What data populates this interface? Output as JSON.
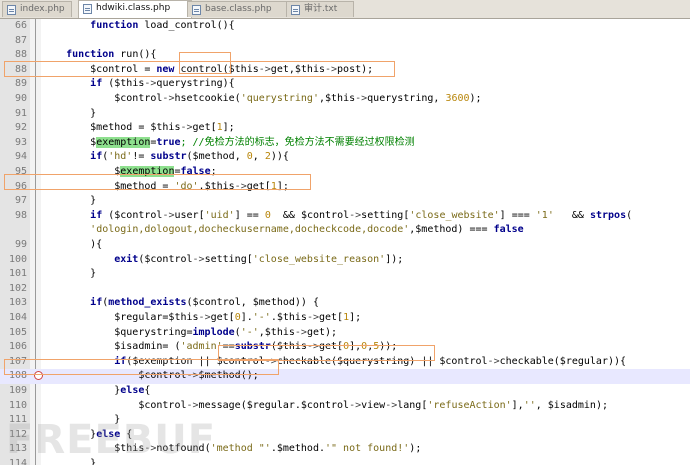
{
  "tabs": [
    {
      "label": "index.php",
      "active": false
    },
    {
      "label": "hdwiki.class.php",
      "active": true
    },
    {
      "label": "base.class.php",
      "active": false
    },
    {
      "label": "审计.txt",
      "active": false
    }
  ],
  "watermark": "FREEBUF",
  "colors": {
    "highlight_box": "#f0a36a",
    "word_highlight": "#8ee08e",
    "current_line": "#e8e8ff"
  },
  "lines": [
    {
      "n": "66",
      "t": [
        [
          "        ",
          "op"
        ],
        [
          "function",
          "kw"
        ],
        [
          " load_control(){",
          "fn"
        ]
      ]
    },
    {
      "n": "87",
      "t": [
        [
          "",
          "op"
        ]
      ]
    },
    {
      "n": "88",
      "t": [
        [
          "    ",
          "op"
        ],
        [
          "function",
          "kw"
        ],
        [
          " run(){",
          "fn"
        ]
      ]
    },
    {
      "n": "88",
      "t": [
        [
          "        $control = ",
          "var"
        ],
        [
          "new",
          "kw"
        ],
        [
          " control($this",
          "var"
        ],
        [
          "->",
          "arrow"
        ],
        [
          "get,$this",
          "var"
        ],
        [
          "->",
          "arrow"
        ],
        [
          "post);",
          "var"
        ]
      ]
    },
    {
      "n": "89",
      "t": [
        [
          "        ",
          "op"
        ],
        [
          "if",
          "kw"
        ],
        [
          " ($this",
          "var"
        ],
        [
          "->",
          "arrow"
        ],
        [
          "querystring){",
          "var"
        ]
      ]
    },
    {
      "n": "90",
      "t": [
        [
          "            $control",
          "var"
        ],
        [
          "->",
          "arrow"
        ],
        [
          "hsetcookie(",
          "fn"
        ],
        [
          "'querystring'",
          "str"
        ],
        [
          ",$this",
          "var"
        ],
        [
          "->",
          "arrow"
        ],
        [
          "querystring, ",
          "var"
        ],
        [
          "3600",
          "num"
        ],
        [
          ");",
          "op"
        ]
      ]
    },
    {
      "n": "91",
      "t": [
        [
          "        }",
          "op"
        ]
      ]
    },
    {
      "n": "92",
      "t": [
        [
          "        $method = $this",
          "var"
        ],
        [
          "->",
          "arrow"
        ],
        [
          "get[",
          "var"
        ],
        [
          "1",
          "num"
        ],
        [
          "];",
          "op"
        ]
      ]
    },
    {
      "n": "93",
      "t": [
        [
          "        $",
          "var"
        ],
        [
          "exemption",
          "var"
        ],
        [
          "=",
          "op"
        ],
        [
          "true",
          "kw"
        ],
        [
          "; //免检方法的标志，免检方法不需要经过权限检测",
          "cmt"
        ]
      ]
    },
    {
      "n": "94",
      "t": [
        [
          "        ",
          "op"
        ],
        [
          "if",
          "kw"
        ],
        [
          "(",
          "op"
        ],
        [
          "'hd'",
          "str"
        ],
        [
          "!= ",
          "op"
        ],
        [
          "substr",
          "kw"
        ],
        [
          "($method, ",
          "var"
        ],
        [
          "0",
          "num"
        ],
        [
          ", ",
          "op"
        ],
        [
          "2",
          "num"
        ],
        [
          ")){",
          "op"
        ]
      ]
    },
    {
      "n": "95",
      "t": [
        [
          "            $",
          "var"
        ],
        [
          "exemption",
          "var"
        ],
        [
          "=",
          "op"
        ],
        [
          "false",
          "kw"
        ],
        [
          ";",
          "op"
        ]
      ]
    },
    {
      "n": "96",
      "t": [
        [
          "            $method = ",
          "var"
        ],
        [
          "'do'",
          "str"
        ],
        [
          ".$this",
          "var"
        ],
        [
          "->",
          "arrow"
        ],
        [
          "get[",
          "var"
        ],
        [
          "1",
          "num"
        ],
        [
          "];",
          "op"
        ]
      ]
    },
    {
      "n": "97",
      "t": [
        [
          "        }",
          "op"
        ]
      ]
    },
    {
      "n": "98",
      "t": [
        [
          "        ",
          "op"
        ],
        [
          "if",
          "kw"
        ],
        [
          " ($control",
          "var"
        ],
        [
          "->",
          "arrow"
        ],
        [
          "user[",
          "var"
        ],
        [
          "'uid'",
          "str"
        ],
        [
          "] == ",
          "op"
        ],
        [
          "0",
          "num"
        ],
        [
          "  && $control",
          "var"
        ],
        [
          "->",
          "arrow"
        ],
        [
          "setting[",
          "var"
        ],
        [
          "'close_website'",
          "str"
        ],
        [
          "] === ",
          "op"
        ],
        [
          "'1'",
          "str"
        ],
        [
          "   && ",
          "op"
        ],
        [
          "strpos",
          "kw"
        ],
        [
          "(",
          "op"
        ]
      ]
    },
    {
      "n": "",
      "t": [
        [
          "        ",
          "op"
        ],
        [
          "'dologin,dologout,docheckusername,docheckcode,docode'",
          "str"
        ],
        [
          ",$method) === ",
          "var"
        ],
        [
          "false",
          "kw"
        ]
      ]
    },
    {
      "n": "99",
      "t": [
        [
          "        ){",
          "op"
        ]
      ]
    },
    {
      "n": "100",
      "t": [
        [
          "            ",
          "op"
        ],
        [
          "exit",
          "kw"
        ],
        [
          "($control",
          "var"
        ],
        [
          "->",
          "arrow"
        ],
        [
          "setting[",
          "var"
        ],
        [
          "'close_website_reason'",
          "str"
        ],
        [
          "]);",
          "op"
        ]
      ]
    },
    {
      "n": "101",
      "t": [
        [
          "        }",
          "op"
        ]
      ]
    },
    {
      "n": "102",
      "t": [
        [
          "",
          "op"
        ]
      ]
    },
    {
      "n": "103",
      "t": [
        [
          "        ",
          "op"
        ],
        [
          "if",
          "kw"
        ],
        [
          "(",
          "op"
        ],
        [
          "method_exists",
          "kw"
        ],
        [
          "($control, $method)) {",
          "var"
        ]
      ]
    },
    {
      "n": "104",
      "t": [
        [
          "            $regular=$this",
          "var"
        ],
        [
          "->",
          "arrow"
        ],
        [
          "get[",
          "var"
        ],
        [
          "0",
          "num"
        ],
        [
          "].",
          "op"
        ],
        [
          "'-'",
          "str"
        ],
        [
          ".$this",
          "var"
        ],
        [
          "->",
          "arrow"
        ],
        [
          "get[",
          "var"
        ],
        [
          "1",
          "num"
        ],
        [
          "];",
          "op"
        ]
      ]
    },
    {
      "n": "105",
      "t": [
        [
          "            $querystring=",
          "var"
        ],
        [
          "implode",
          "kw"
        ],
        [
          "(",
          "op"
        ],
        [
          "'-'",
          "str"
        ],
        [
          ",$this",
          "var"
        ],
        [
          "->",
          "arrow"
        ],
        [
          "get);",
          "var"
        ]
      ]
    },
    {
      "n": "106",
      "t": [
        [
          "            $isadmin= (",
          "var"
        ],
        [
          "'admin'",
          "str"
        ],
        [
          "==",
          "op"
        ],
        [
          "substr",
          "kw"
        ],
        [
          "($this",
          "var"
        ],
        [
          "->",
          "arrow"
        ],
        [
          "get[",
          "var"
        ],
        [
          "0",
          "num"
        ],
        [
          "],",
          "op"
        ],
        [
          "0",
          "num"
        ],
        [
          ",",
          "op"
        ],
        [
          "5",
          "num"
        ],
        [
          "));",
          "op"
        ]
      ]
    },
    {
      "n": "107",
      "t": [
        [
          "            ",
          "op"
        ],
        [
          "if",
          "kw"
        ],
        [
          "($",
          "var"
        ],
        [
          "exemption",
          "var"
        ],
        [
          " || $control",
          "var"
        ],
        [
          "->",
          "arrow"
        ],
        [
          "checkable($querystring) || $control",
          "var"
        ],
        [
          "->",
          "arrow"
        ],
        [
          "checkable($regular)){",
          "var"
        ]
      ]
    },
    {
      "n": "108",
      "t": [
        [
          "                $control",
          "var"
        ],
        [
          "->",
          "arrow"
        ],
        [
          "$method();",
          "var"
        ]
      ]
    },
    {
      "n": "109",
      "t": [
        [
          "            }",
          "op"
        ],
        [
          "else",
          "kw"
        ],
        [
          "{",
          "op"
        ]
      ]
    },
    {
      "n": "110",
      "t": [
        [
          "                $control",
          "var"
        ],
        [
          "->",
          "arrow"
        ],
        [
          "message($regular.$control",
          "var"
        ],
        [
          "->",
          "arrow"
        ],
        [
          "view",
          "var"
        ],
        [
          "->",
          "arrow"
        ],
        [
          "lang[",
          "var"
        ],
        [
          "'refuseAction'",
          "str"
        ],
        [
          "],",
          "op"
        ],
        [
          "''",
          "str"
        ],
        [
          ", $isadmin);",
          "var"
        ]
      ]
    },
    {
      "n": "111",
      "t": [
        [
          "            }",
          "op"
        ]
      ]
    },
    {
      "n": "112",
      "t": [
        [
          "        }",
          "op"
        ],
        [
          "else",
          "kw"
        ],
        [
          " {",
          "op"
        ]
      ]
    },
    {
      "n": "113",
      "t": [
        [
          "            $this",
          "var"
        ],
        [
          "->",
          "arrow"
        ],
        [
          "notfound(",
          "fn"
        ],
        [
          "'method \"'",
          "str"
        ],
        [
          ".$method.",
          "var"
        ],
        [
          "'\" not found!'",
          "str"
        ],
        [
          ");",
          "op"
        ]
      ]
    },
    {
      "n": "114",
      "t": [
        [
          "        }",
          "op"
        ]
      ]
    }
  ]
}
